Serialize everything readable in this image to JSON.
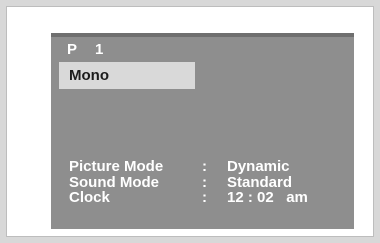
{
  "osd": {
    "program_label": "P",
    "program_number": "1",
    "audio_mode": "Mono",
    "rows": [
      {
        "label": "Picture Mode",
        "sep": ":",
        "value": "Dynamic"
      },
      {
        "label": "Sound Mode",
        "sep": ":",
        "value": "Standard"
      },
      {
        "label": "Clock",
        "sep": ":",
        "value": "12 : 02   am"
      }
    ]
  },
  "colors": {
    "screen_bg": "#8e8e8e",
    "highlight_bg": "#d9d9d9",
    "text": "#ffffff"
  }
}
